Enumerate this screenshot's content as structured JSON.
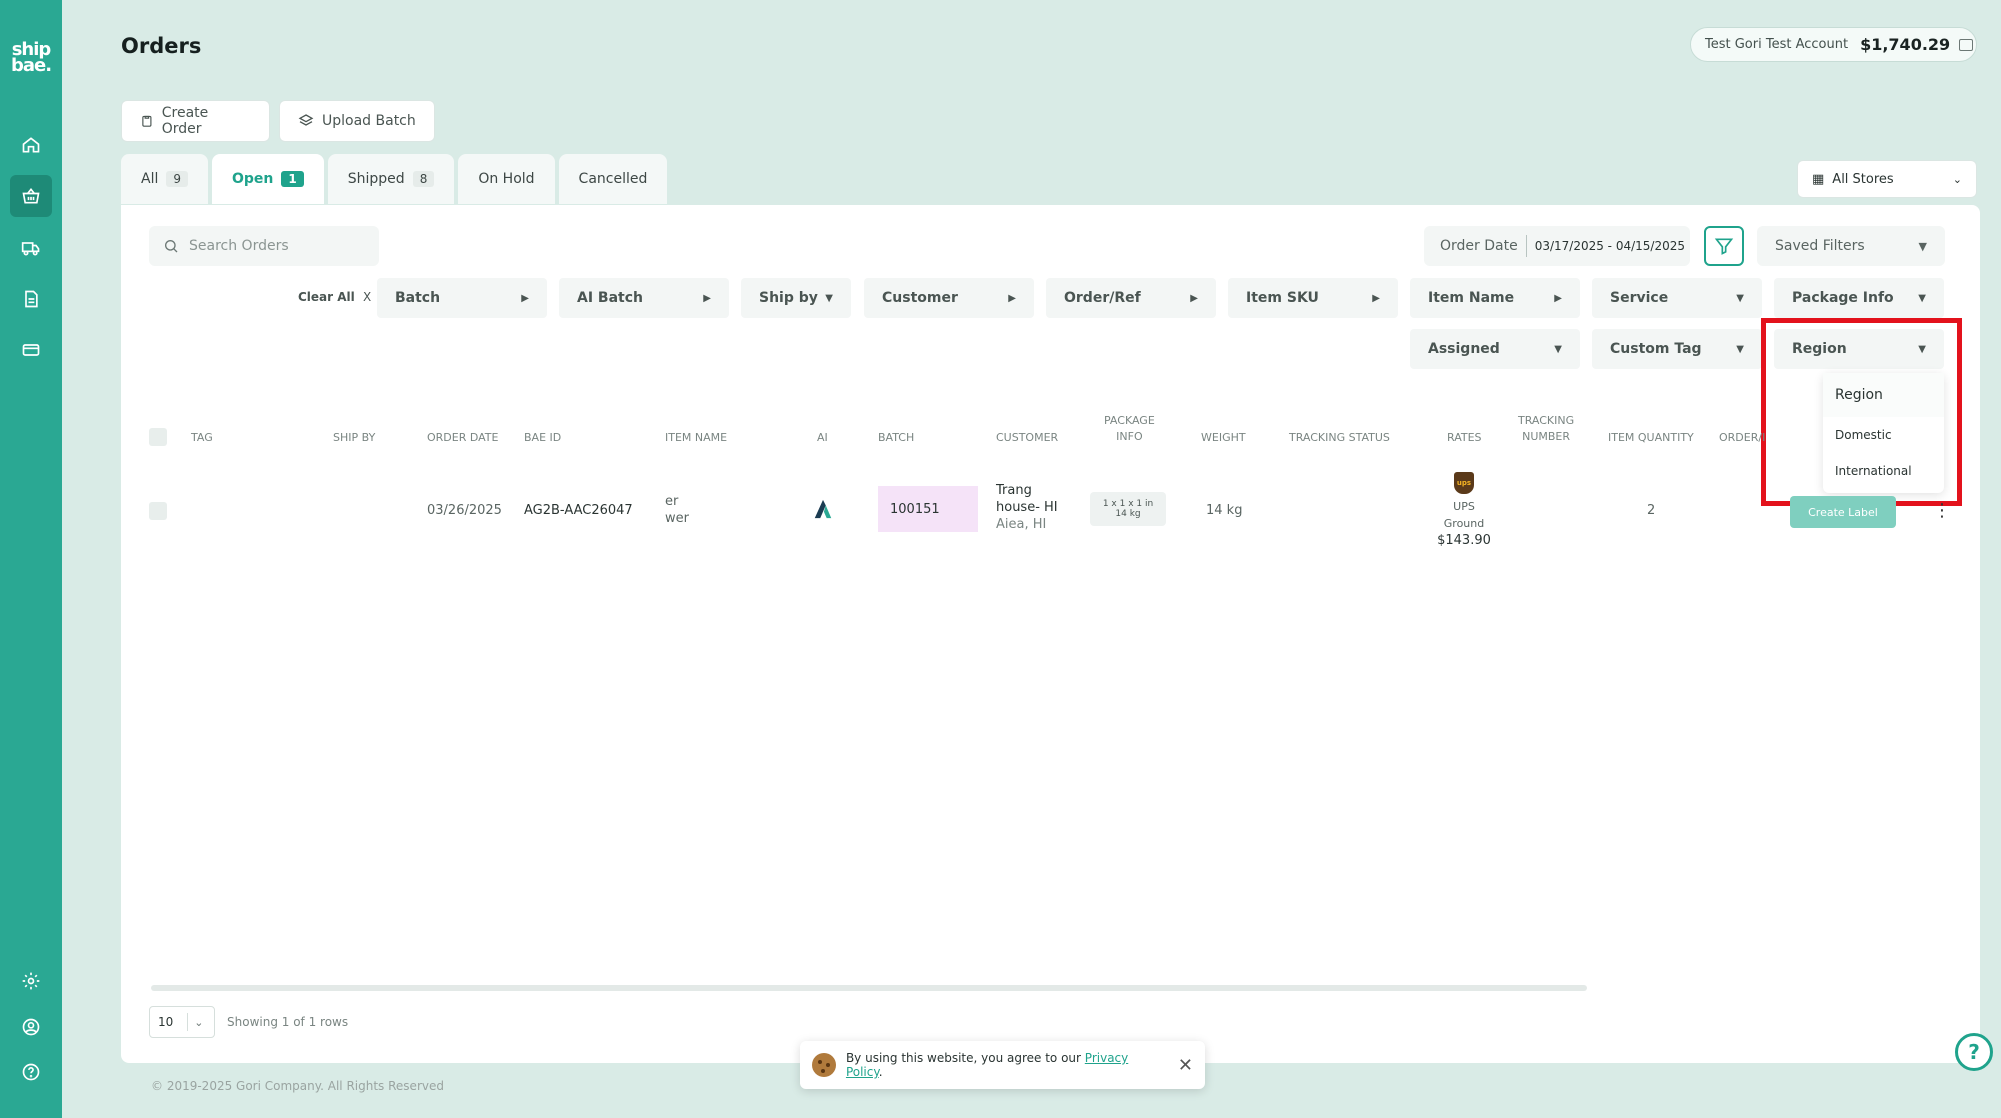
{
  "app": {
    "logo_line1": "ship",
    "logo_line2": "bae.",
    "page_title": "Orders"
  },
  "sidebar": {
    "items": [
      {
        "icon": "home-icon",
        "active": false
      },
      {
        "icon": "basket-icon",
        "active": true
      },
      {
        "icon": "truck-icon",
        "active": false
      },
      {
        "icon": "document-icon",
        "active": false
      },
      {
        "icon": "card-icon",
        "active": false
      }
    ],
    "bottom_items": [
      {
        "icon": "gear-icon"
      },
      {
        "icon": "user-circle-icon"
      },
      {
        "icon": "help-circle-icon"
      }
    ]
  },
  "account": {
    "name": "Test Gori Test Account",
    "balance": "$1,740.29"
  },
  "toolbar": {
    "create_order": "Create Order",
    "upload_batch": "Upload Batch"
  },
  "tabs": [
    {
      "label": "All",
      "count": "9"
    },
    {
      "label": "Open",
      "count": "1"
    },
    {
      "label": "Shipped",
      "count": "8"
    },
    {
      "label": "On Hold",
      "count": ""
    },
    {
      "label": "Cancelled",
      "count": ""
    }
  ],
  "stores": {
    "selected": "All Stores"
  },
  "search": {
    "placeholder": "Search Orders"
  },
  "date_filter": {
    "label": "Order Date",
    "range": "03/17/2025 - 04/15/2025"
  },
  "saved_filters": "Saved Filters",
  "filters": {
    "clear_all": "Clear All",
    "clear_x": "X",
    "batch": "Batch",
    "ai_batch": "AI Batch",
    "ship_by": "Ship by",
    "customer": "Customer",
    "order_ref": "Order/Ref",
    "item_sku": "Item SKU",
    "item_name": "Item Name",
    "service": "Service",
    "package_info": "Package Info",
    "assigned": "Assigned",
    "custom_tag": "Custom Tag",
    "region": "Region"
  },
  "region_menu": {
    "header": "Region",
    "options": [
      "Domestic",
      "International"
    ]
  },
  "table": {
    "headers": {
      "tag": "TAG",
      "ship_by": "SHIP BY",
      "order_date": "ORDER DATE",
      "bae_id": "BAE ID",
      "item_name": "ITEM NAME",
      "ai": "AI",
      "batch": "BATCH",
      "customer": "CUSTOMER",
      "package_info_1": "PACKAGE",
      "package_info_2": "INFO",
      "weight": "WEIGHT",
      "tracking_status": "TRACKING STATUS",
      "rates": "RATES",
      "tracking_number_1": "TRACKING",
      "tracking_number_2": "NUMBER",
      "item_quantity": "ITEM QUANTITY",
      "order_ref": "ORDER/I"
    },
    "rows": [
      {
        "order_date": "03/26/2025",
        "bae_id": "AG2B-AAC26047",
        "item_name_1": "er",
        "item_name_2": "wer",
        "batch": "100151",
        "customer_name_1": "Trang",
        "customer_name_2": "house- HI",
        "customer_location": "Aiea, HI",
        "package_1": "1 x 1 x 1 in",
        "package_2": "14 kg",
        "weight": "14 kg",
        "carrier_logo": "ups",
        "carrier": "UPS",
        "service": "Ground",
        "rate": "$143.90",
        "item_quantity": "2",
        "action": "Create Label"
      }
    ]
  },
  "pagination": {
    "page_size": "10",
    "showing": "Showing 1 of 1 rows"
  },
  "footer": "© 2019-2025 Gori Company. All Rights Reserved",
  "cookie": {
    "text": "By using this website, you agree to our ",
    "link": "Privacy Policy",
    "period": "."
  },
  "colors": {
    "brand": "#2aa893",
    "highlight": "#e3121c",
    "batch_bg": "#f5e3f8"
  }
}
